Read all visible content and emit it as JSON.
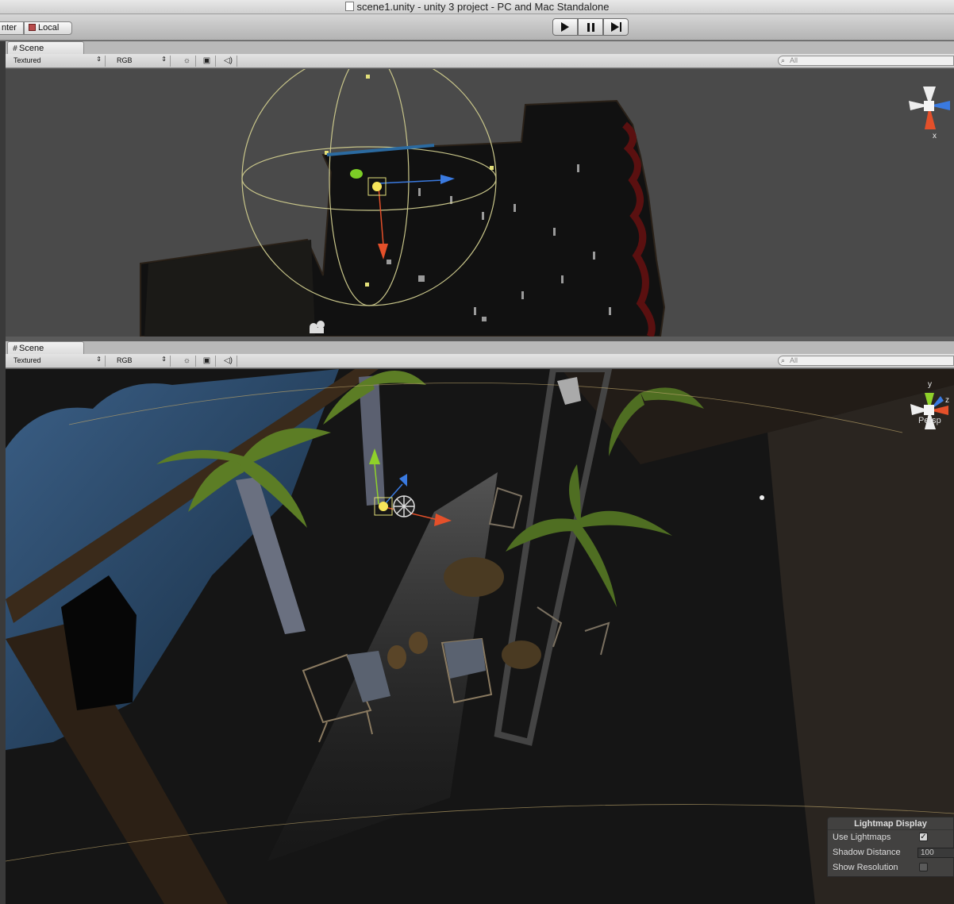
{
  "window": {
    "title": "scene1.unity - unity 3 project - PC and Mac Standalone"
  },
  "toolbar": {
    "pivot_label": "nter",
    "space_label": "Local",
    "play_icon": "play-icon",
    "pause_icon": "pause-icon",
    "step_icon": "step-icon"
  },
  "scene_top": {
    "tab_label": "Scene",
    "render_mode": "Textured",
    "color_mode": "RGB",
    "search_placeholder": "All",
    "gizmo_axis": "x"
  },
  "scene_bottom": {
    "tab_label": "Scene",
    "render_mode": "Textured",
    "color_mode": "RGB",
    "search_placeholder": "All",
    "gizmo_axis_y": "y",
    "gizmo_axis_z": "z",
    "projection": "Persp"
  },
  "lightmap_display": {
    "title": "Lightmap Display",
    "use_lightmaps_label": "Use Lightmaps",
    "use_lightmaps": true,
    "shadow_distance_label": "Shadow Distance",
    "shadow_distance": "100",
    "show_resolution_label": "Show Resolution",
    "show_resolution": false
  },
  "colors": {
    "viewport_bg_top": "#4a4a4a",
    "axis_x": "#e4502a",
    "axis_y": "#8fd12a",
    "axis_z": "#3a7ae0",
    "light_range": "#c9c68a"
  }
}
